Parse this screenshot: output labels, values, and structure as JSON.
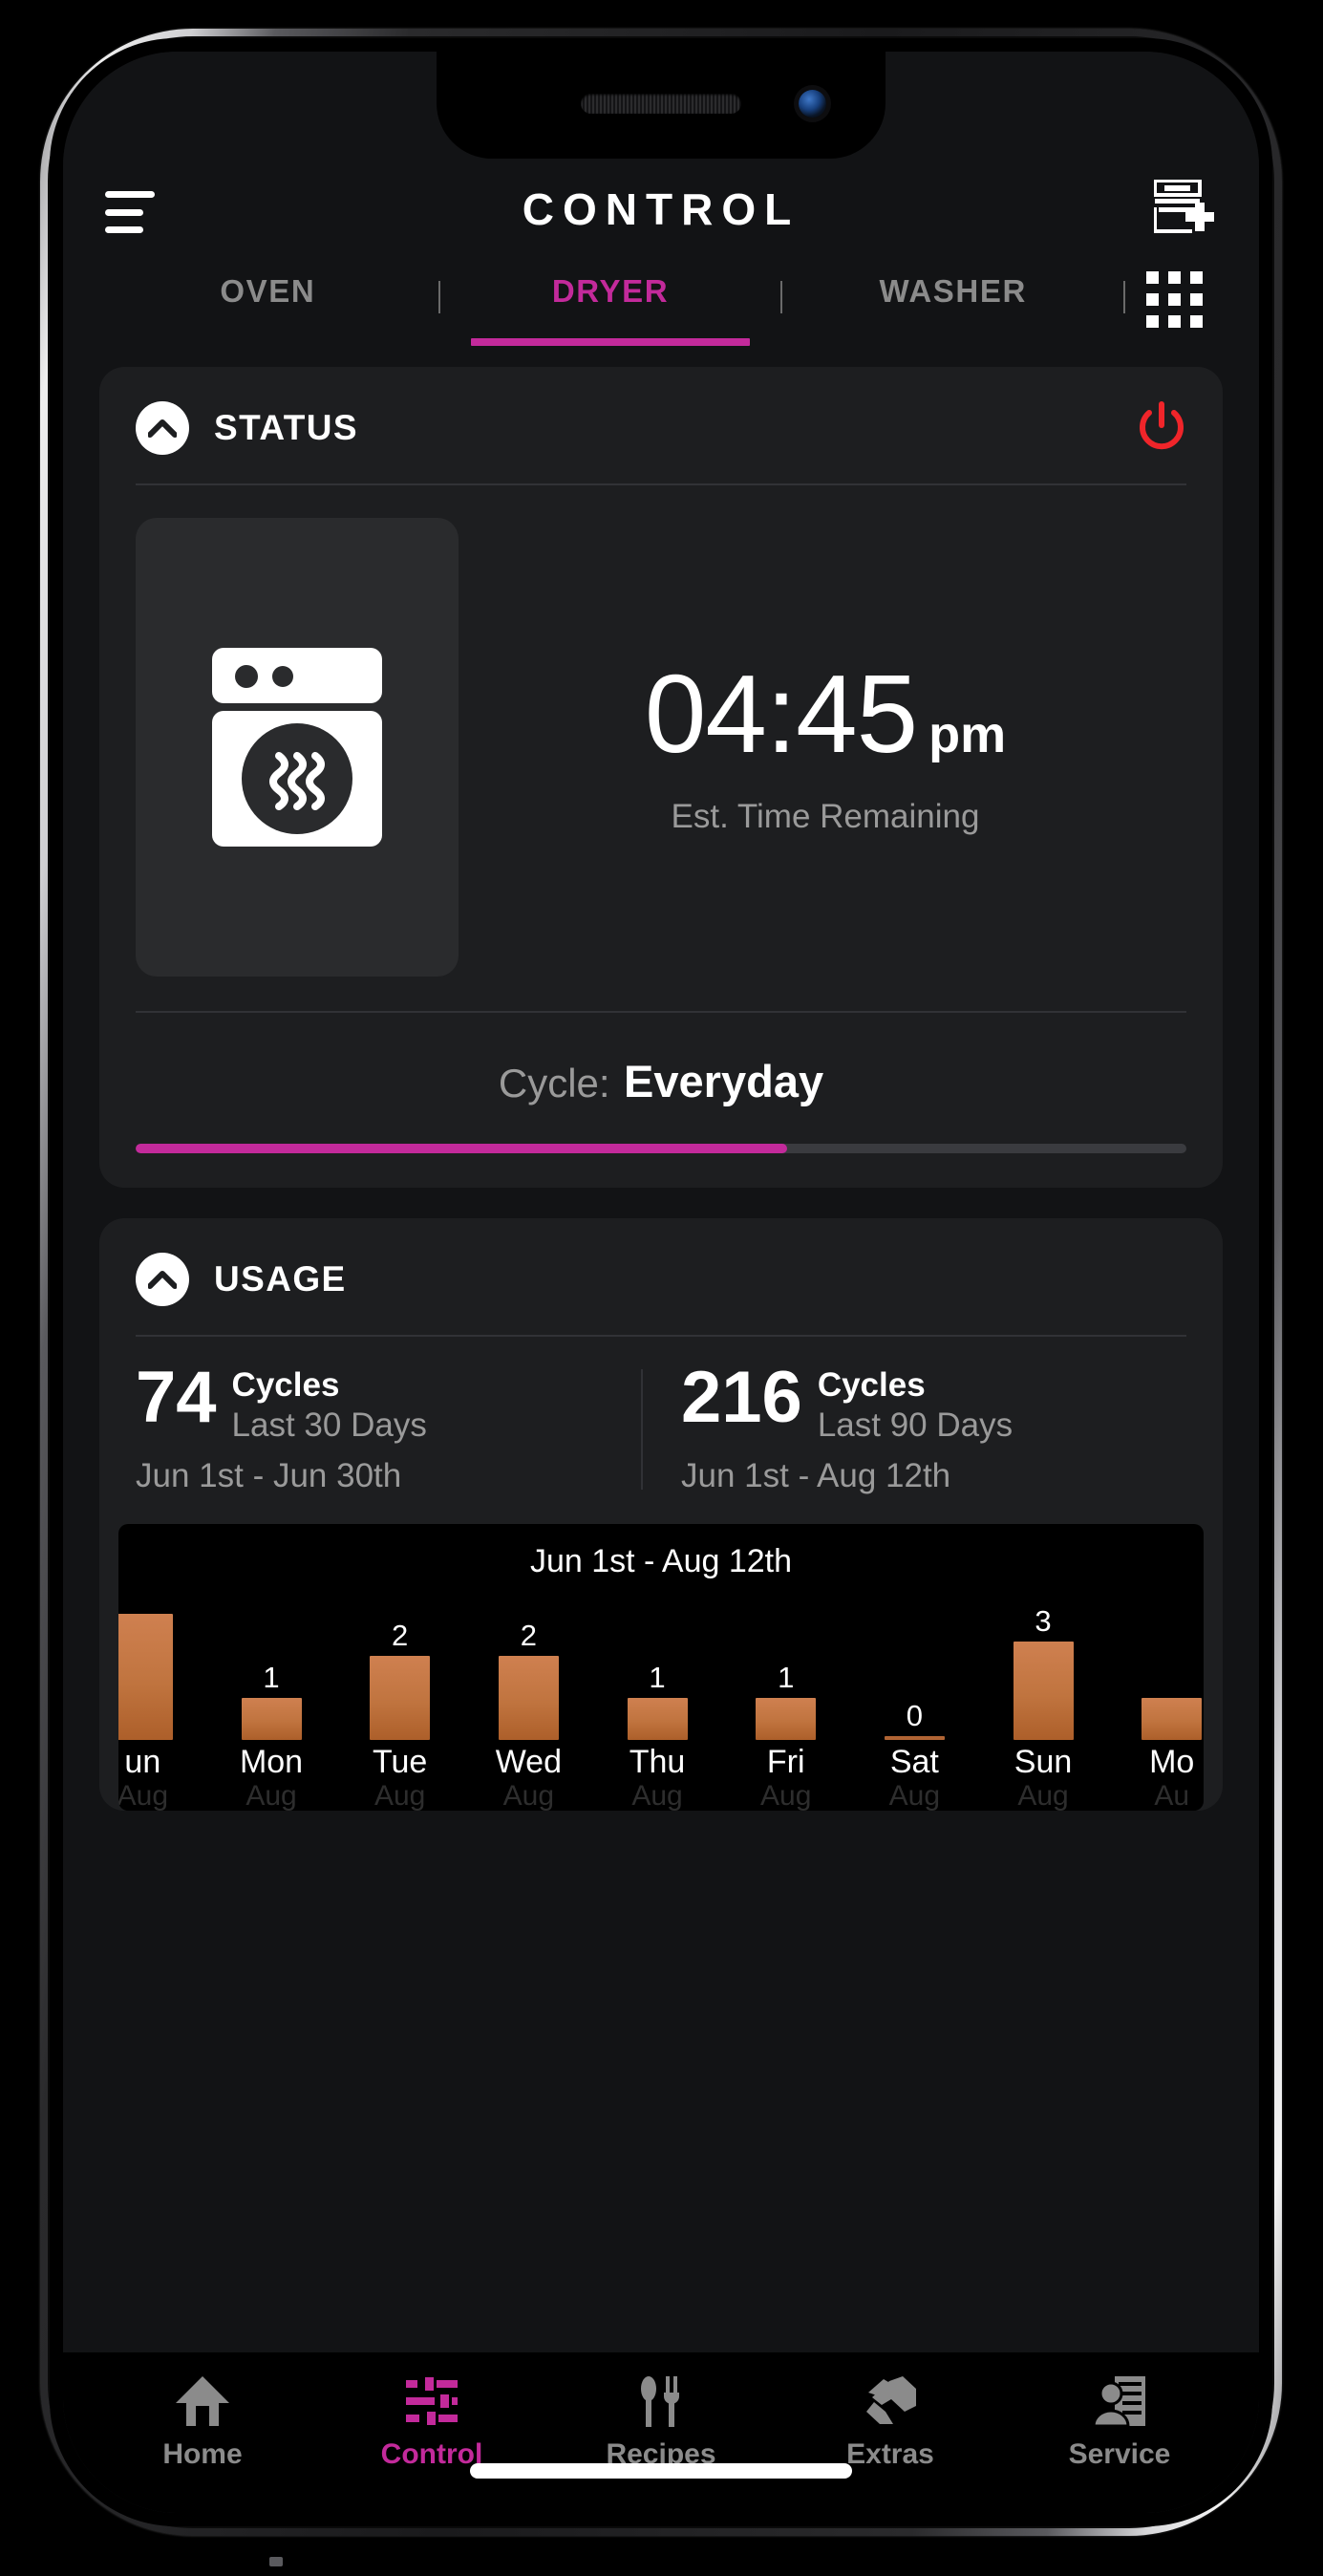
{
  "header": {
    "title": "CONTROL",
    "menu_icon": "hamburger-menu-icon",
    "add_icon": "add-appliance-icon"
  },
  "tabs": {
    "items": [
      {
        "label": "OVEN",
        "active": false
      },
      {
        "label": "DRYER",
        "active": true
      },
      {
        "label": "WASHER",
        "active": false
      }
    ],
    "grid_icon": "grid-apps-icon",
    "accent": "#c32a9b"
  },
  "status_card": {
    "title": "STATUS",
    "collapse_icon": "chevron-up-icon",
    "power_icon": "power-icon",
    "power_color": "#f0252a",
    "appliance_icon": "dryer-icon",
    "time": "04:45",
    "ampm": "pm",
    "time_caption": "Est. Time Remaining",
    "cycle_label": "Cycle:",
    "cycle_value": "Everyday",
    "progress_percent": 62
  },
  "usage_card": {
    "title": "USAGE",
    "collapse_icon": "chevron-up-icon",
    "stats": [
      {
        "number": "74",
        "unit": "Cycles",
        "range": "Last 30 Days",
        "dates": "Jun 1st - Jun 30th"
      },
      {
        "number": "216",
        "unit": "Cycles",
        "range": "Last 90 Days",
        "dates": "Jun 1st - Aug 12th"
      }
    ]
  },
  "chart_data": {
    "type": "bar",
    "title": "Jun 1st - Aug 12th",
    "xlabel": "",
    "ylabel": "",
    "ylim": [
      0,
      3
    ],
    "grid": false,
    "legend": "none",
    "bar_color": "#c0743f",
    "categories": [
      "un",
      "Mon",
      "Tue",
      "Wed",
      "Thu",
      "Fri",
      "Sat",
      "Sun",
      "Mo"
    ],
    "sub_labels": [
      "Aug",
      "Aug",
      "Aug",
      "Aug",
      "Aug",
      "Aug",
      "Aug",
      "Aug",
      "Au"
    ],
    "values": [
      3,
      1,
      2,
      2,
      1,
      1,
      0,
      3,
      1
    ],
    "show_values": [
      false,
      true,
      true,
      true,
      true,
      true,
      true,
      true,
      false
    ],
    "clipped_left": true,
    "clipped_right": true
  },
  "bottom_nav": {
    "items": [
      {
        "label": "Home",
        "icon": "home-icon",
        "active": false
      },
      {
        "label": "Control",
        "icon": "sliders-icon",
        "active": true
      },
      {
        "label": "Recipes",
        "icon": "utensils-icon",
        "active": false
      },
      {
        "label": "Extras",
        "icon": "handshake-icon",
        "active": false
      },
      {
        "label": "Service",
        "icon": "support-agent-icon",
        "active": false
      }
    ]
  }
}
